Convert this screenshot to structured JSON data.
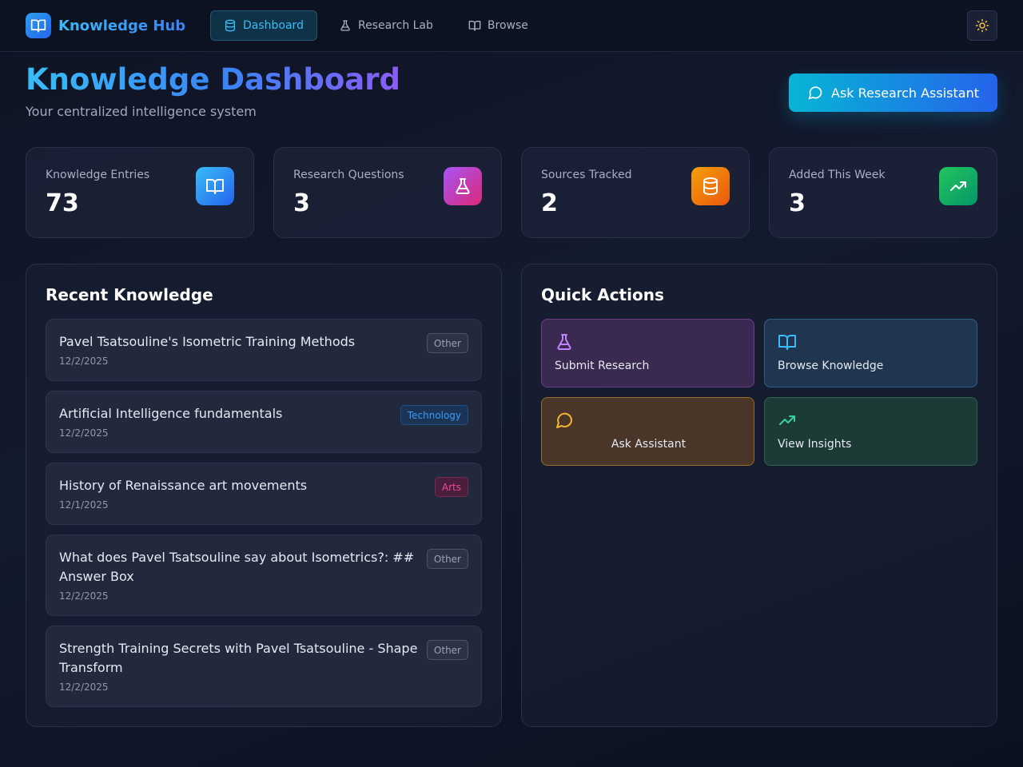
{
  "app": {
    "name": "Knowledge Hub"
  },
  "nav": {
    "tabs": [
      {
        "label": "Dashboard",
        "icon": "database-icon",
        "active": true
      },
      {
        "label": "Research Lab",
        "icon": "flask-icon",
        "active": false
      },
      {
        "label": "Browse",
        "icon": "book-open-icon",
        "active": false
      }
    ],
    "theme_toggle_icon": "sun-icon"
  },
  "header": {
    "title": "Knowledge Dashboard",
    "subtitle": "Your centralized intelligence system",
    "ask_button": "Ask Research Assistant"
  },
  "stats": [
    {
      "label": "Knowledge Entries",
      "value": "73",
      "icon": "book-open-icon",
      "color": "#2b9ff0"
    },
    {
      "label": "Research Questions",
      "value": "3",
      "icon": "flask-icon",
      "color": "#c026d3"
    },
    {
      "label": "Sources Tracked",
      "value": "2",
      "icon": "database-icon",
      "color": "#f97316"
    },
    {
      "label": "Added This Week",
      "value": "3",
      "icon": "trending-up-icon",
      "color": "#16a34a"
    }
  ],
  "recent": {
    "title": "Recent Knowledge",
    "items": [
      {
        "title": "Pavel Tsatsouline's Isometric Training Methods",
        "date": "12/2/2025",
        "tag": "Other"
      },
      {
        "title": "Artificial Intelligence fundamentals",
        "date": "12/2/2025",
        "tag": "Technology"
      },
      {
        "title": "History of Renaissance art movements",
        "date": "12/1/2025",
        "tag": "Arts"
      },
      {
        "title": "What does Pavel Tsatsouline say about Isometrics?: ## Answer Box",
        "date": "12/2/2025",
        "tag": "Other"
      },
      {
        "title": "Strength Training Secrets with Pavel Tsatsouline - Shape Transform",
        "date": "12/2/2025",
        "tag": "Other"
      }
    ]
  },
  "quick_actions": {
    "title": "Quick Actions",
    "items": [
      {
        "label": "Submit Research",
        "icon": "flask-icon"
      },
      {
        "label": "Browse Knowledge",
        "icon": "book-open-icon"
      },
      {
        "label": "Ask Assistant",
        "icon": "message-circle-icon"
      },
      {
        "label": "View Insights",
        "icon": "trending-up-icon"
      }
    ]
  }
}
